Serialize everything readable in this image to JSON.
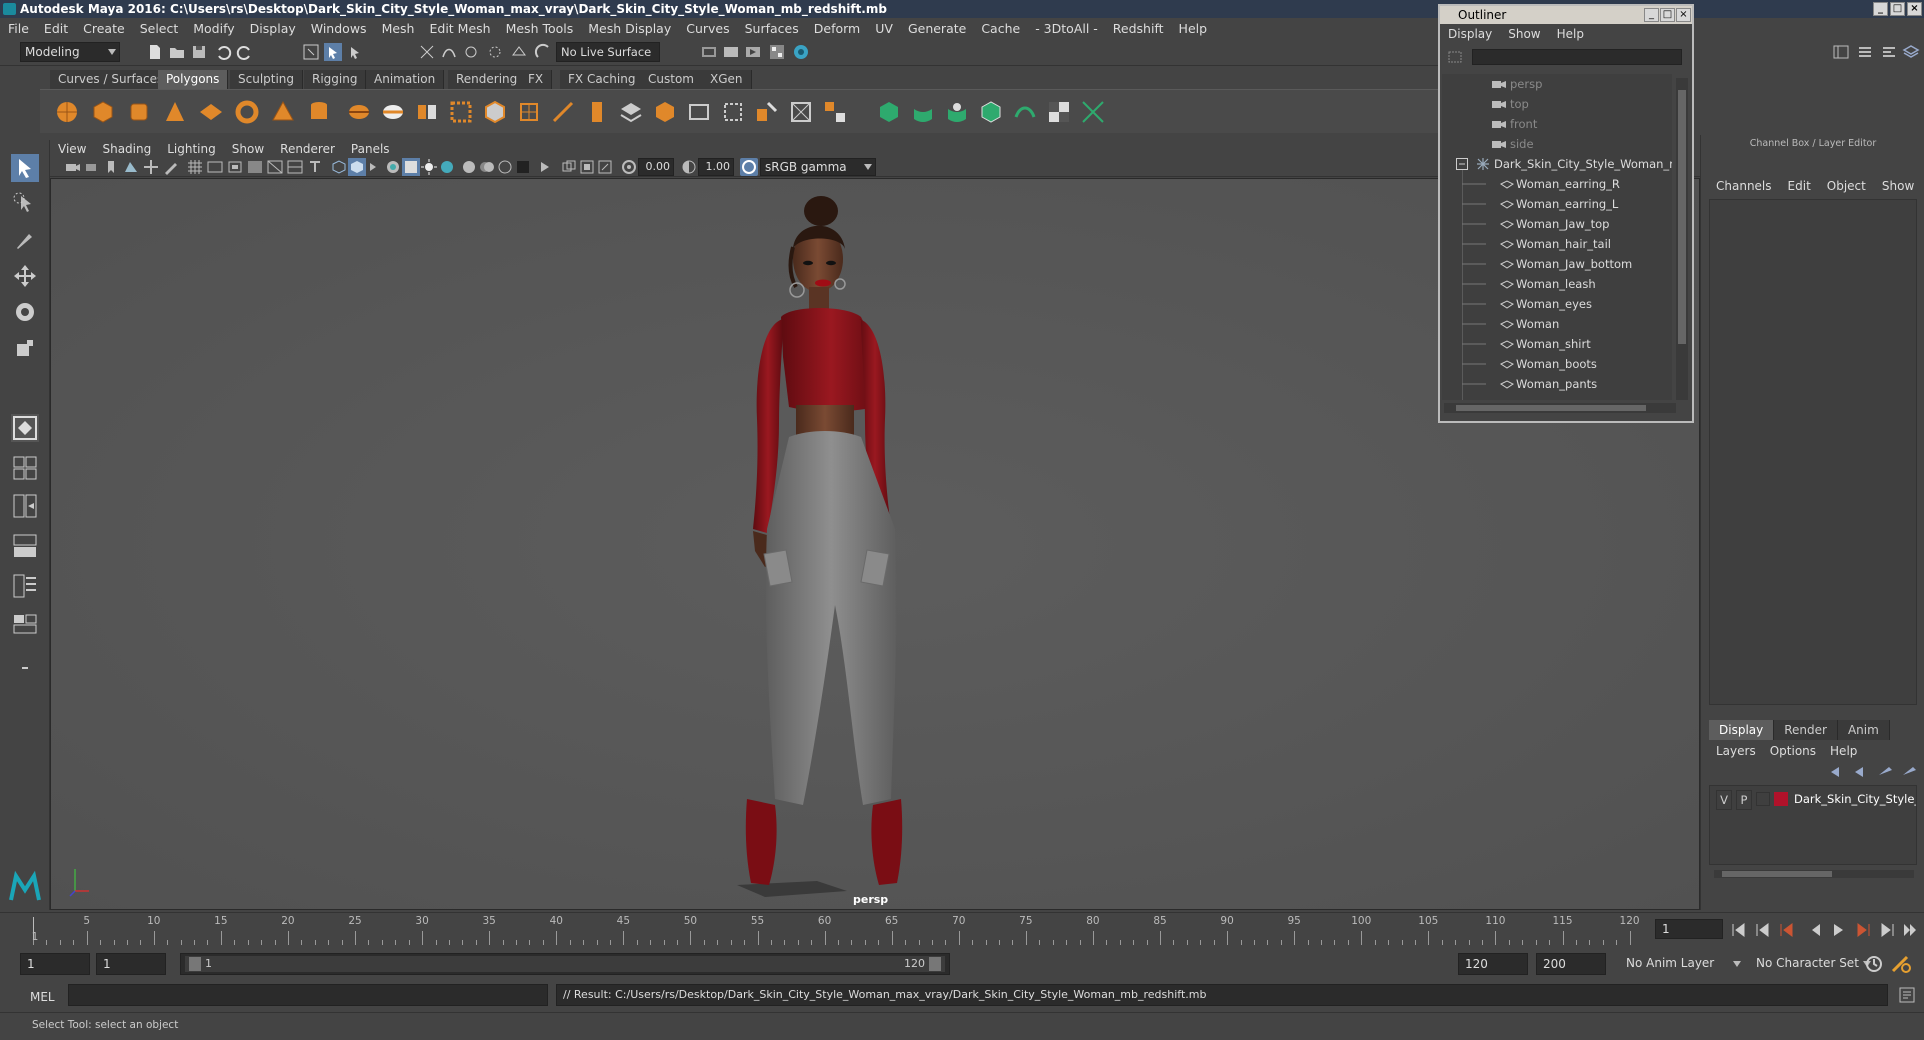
{
  "window": {
    "title": "Autodesk Maya 2016: C:\\Users\\rs\\Desktop\\Dark_Skin_City_Style_Woman_max_vray\\Dark_Skin_City_Style_Woman_mb_redshift.mb"
  },
  "menubar": [
    "File",
    "Edit",
    "Create",
    "Select",
    "Modify",
    "Display",
    "Windows",
    "Mesh",
    "Edit Mesh",
    "Mesh Tools",
    "Mesh Display",
    "Curves",
    "Surfaces",
    "Deform",
    "UV",
    "Generate",
    "Cache",
    "- 3DtoAll -",
    "Redshift",
    "Help"
  ],
  "statusline": {
    "mode": "Modeling",
    "live_surface": "No Live Surface"
  },
  "shelf": {
    "tabs": [
      "Curves / Surfaces",
      "Polygons",
      "Sculpting",
      "Rigging",
      "Animation",
      "Rendering",
      "FX",
      "FX Caching",
      "Custom",
      "XGen"
    ],
    "active_tab": "Polygons"
  },
  "panel": {
    "menu": [
      "View",
      "Shading",
      "Lighting",
      "Show",
      "Renderer",
      "Panels"
    ],
    "exposure": "0.00",
    "gamma": "1.00",
    "color_space": "sRGB gamma",
    "camera": "persp"
  },
  "outliner": {
    "title": "Outliner",
    "menu": [
      "Display",
      "Show",
      "Help"
    ],
    "cameras": [
      "persp",
      "top",
      "front",
      "side"
    ],
    "group": "Dark_Skin_City_Style_Woman_ncl",
    "children": [
      "Woman_earring_R",
      "Woman_earring_L",
      "Woman_Jaw_top",
      "Woman_hair_tail",
      "Woman_Jaw_bottom",
      "Woman_leash",
      "Woman_eyes",
      "Woman",
      "Woman_shirt",
      "Woman_boots",
      "Woman_pants"
    ]
  },
  "channelbox": {
    "title": "Channel Box / Layer Editor",
    "menu": [
      "Channels",
      "Edit",
      "Object",
      "Show"
    ],
    "layer_tabs": [
      "Display",
      "Render",
      "Anim"
    ],
    "active_layer_tab": "Display",
    "layer_menu": [
      "Layers",
      "Options",
      "Help"
    ],
    "layer": {
      "v": "V",
      "p": "P",
      "name": "Dark_Skin_City_Style_V",
      "color": "#b0122a"
    }
  },
  "timeslider": {
    "ticks": [
      5,
      10,
      15,
      20,
      25,
      30,
      35,
      40,
      45,
      50,
      55,
      60,
      65,
      70,
      75,
      80,
      85,
      90,
      95,
      100,
      105,
      110,
      115,
      120
    ],
    "start_label": "1",
    "current_frame": "1"
  },
  "range": {
    "start": "1",
    "playback_start": "1",
    "handle_start": "1",
    "handle_end": "120",
    "playback_end": "120",
    "end": "200",
    "anim_layer": "No Anim Layer",
    "character_set": "No Character Set"
  },
  "command": {
    "lang": "MEL",
    "result": "// Result: C:/Users/rs/Desktop/Dark_Skin_City_Style_Woman_max_vray/Dark_Skin_City_Style_Woman_mb_redshift.mb"
  },
  "help_line": "Select Tool: select an object",
  "colors": {
    "accent": "#5d7fa8",
    "shirt": "#8e1218",
    "pants": "#7b7b7b",
    "boots": "#7a0d14"
  }
}
